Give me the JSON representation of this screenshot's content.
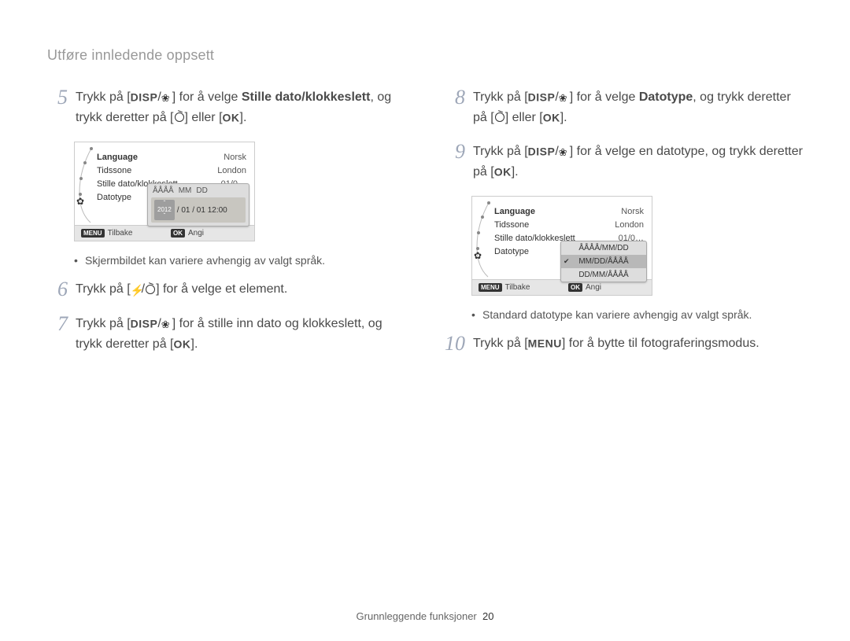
{
  "header": "Utføre innledende oppsett",
  "labels": {
    "disp": "DISP",
    "ok": "OK",
    "menu": "MENU"
  },
  "left": {
    "step5": {
      "num": "5",
      "t1": "Trykk på [",
      "t2": "/",
      "t3": "] for å velge ",
      "bold": "Stille dato/klokkeslett",
      "t4": ", og trykk deretter på [",
      "t5": "] eller [",
      "t6": "]."
    },
    "screen1": {
      "rows": [
        {
          "k": "Language",
          "v": "Norsk",
          "bold": true
        },
        {
          "k": "Tidssone",
          "v": "London"
        },
        {
          "k": "Stille dato/klokkeslett",
          "v": "01/0…"
        },
        {
          "k": "Datotype",
          "v": ""
        }
      ],
      "overlay_hdr": [
        "ÅÅÅÅ",
        "MM",
        "DD"
      ],
      "overlay_spin": "2012",
      "overlay_rest": "/ 01 / 01 12:00",
      "footer_left": "Tilbake",
      "footer_left_badge": "MENU",
      "footer_right": "Angi",
      "footer_right_badge": "OK"
    },
    "note1": "Skjermbildet kan variere avhengig av valgt språk.",
    "step6": {
      "num": "6",
      "t1": "Trykk på [",
      "t2": "/",
      "t3": "] for å velge et element."
    },
    "step7": {
      "num": "7",
      "t1": "Trykk på [",
      "t2": "/",
      "t3": "] for å stille inn dato og klokkeslett, og trykk deretter på [",
      "t4": "]."
    }
  },
  "right": {
    "step8": {
      "num": "8",
      "t1": "Trykk på [",
      "t2": "/",
      "t3": "] for å velge ",
      "bold": "Datotype",
      "t4": ", og trykk deretter på [",
      "t5": "] eller [",
      "t6": "]."
    },
    "step9": {
      "num": "9",
      "t1": "Trykk på [",
      "t2": "/",
      "t3": "] for å velge en datotype, og trykk deretter på [",
      "t4": "]."
    },
    "screen2": {
      "rows": [
        {
          "k": "Language",
          "v": "Norsk",
          "bold": true
        },
        {
          "k": "Tidssone",
          "v": "London"
        },
        {
          "k": "Stille dato/klokkeslett",
          "v": "01/0…"
        },
        {
          "k": "Datotype",
          "v": ""
        }
      ],
      "opts": [
        "ÅÅÅÅ/MM/DD",
        "MM/DD/ÅÅÅÅ",
        "DD/MM/ÅÅÅÅ"
      ],
      "sel": 1,
      "footer_left": "Tilbake",
      "footer_left_badge": "MENU",
      "footer_right": "Angi",
      "footer_right_badge": "OK"
    },
    "note2": "Standard datotype kan variere avhengig av valgt språk.",
    "step10": {
      "num": "10",
      "t1": "Trykk på [",
      "t2": "] for å bytte til fotograferingsmodus."
    }
  },
  "footer": {
    "label": "Grunnleggende funksjoner",
    "page": "20"
  }
}
